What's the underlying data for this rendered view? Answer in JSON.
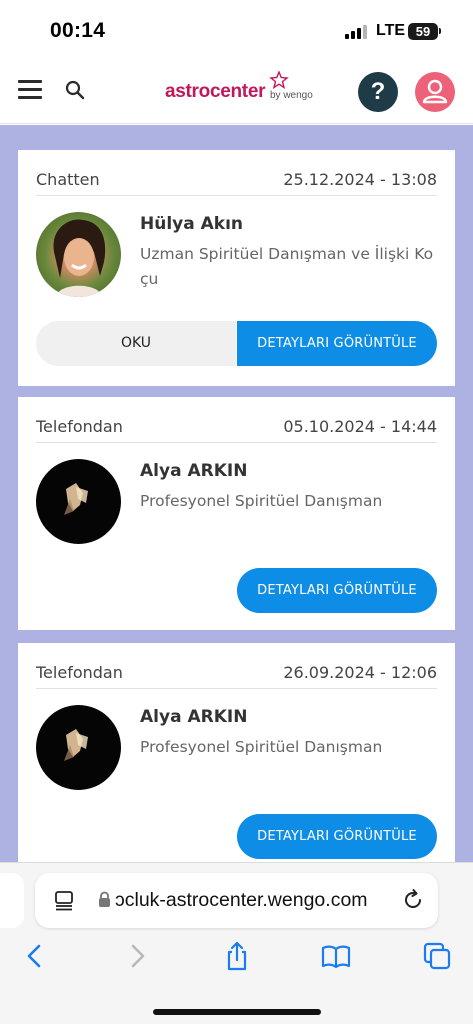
{
  "status_bar": {
    "time": "00:14",
    "network": "LTE",
    "battery": "59"
  },
  "header": {
    "logo_main": "astrocenter",
    "logo_sub": "by wengo",
    "help_label": "?"
  },
  "sessions": [
    {
      "source": "Chatten",
      "date": "25.12.2024 - 13:08",
      "advisor_name": "Hülya Akın",
      "advisor_title": "Uzman Spiritüel Danışman ve İlişki Koçu",
      "read_label": "OKU",
      "details_label": "DETAYLARI GÖRÜNTÜLE"
    },
    {
      "source": "Telefondan",
      "date": "05.10.2024 - 14:44",
      "advisor_name": "Alya ARKIN",
      "advisor_title": "Profesyonel Spiritüel Danışman",
      "details_label": "DETAYLARI GÖRÜNTÜLE"
    },
    {
      "source": "Telefondan",
      "date": "26.09.2024 - 12:06",
      "advisor_name": "Alya ARKIN",
      "advisor_title": "Profesyonel Spiritüel Danışman",
      "details_label": "DETAYLARI GÖRÜNTÜLE"
    }
  ],
  "browser": {
    "url": "ɔcluk-astrocenter.wengo.com"
  },
  "colors": {
    "brand": "#c2185b",
    "accent_blue": "#0e8de6",
    "page_background": "#aeb2e3",
    "help_button": "#1f3b47",
    "user_button": "#ee6279"
  },
  "icons": [
    "hamburger-icon",
    "search-icon",
    "help-icon",
    "user-icon",
    "page-icon",
    "lock-icon",
    "reload-icon",
    "back-icon",
    "forward-icon",
    "share-icon",
    "bookmarks-icon",
    "tabs-icon"
  ]
}
